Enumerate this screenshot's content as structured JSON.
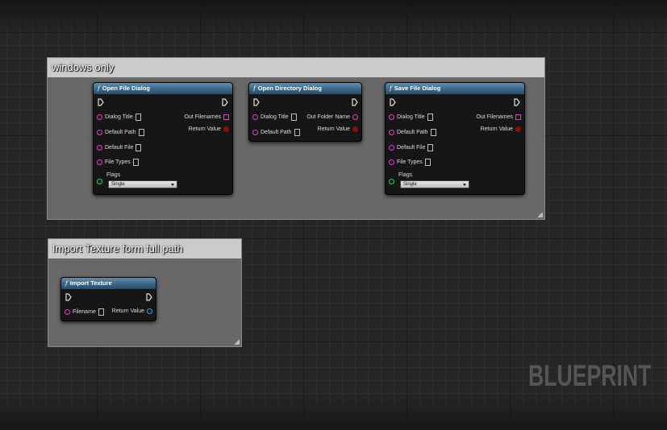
{
  "comments": {
    "windows_only": {
      "title": "windows only"
    },
    "import_texture": {
      "title": "Import Texture form  full path"
    }
  },
  "nodes": {
    "open_file": {
      "title": "Open File Dialog",
      "inputs": [
        "Dialog Title",
        "Default Path",
        "Default File",
        "File Types"
      ],
      "outputs": [
        "Out Filenames",
        "Return Value"
      ],
      "flags_label": "Flags",
      "flags_value": "Single"
    },
    "open_directory": {
      "title": "Open Directory Dialog",
      "inputs": [
        "Dialog Title",
        "Default Path"
      ],
      "outputs": [
        "Out Folder Name",
        "Return Value"
      ]
    },
    "save_file": {
      "title": "Save File Dialog",
      "inputs": [
        "Dialog Title",
        "Default Path",
        "Default File",
        "File Types"
      ],
      "outputs": [
        "Out Filenames",
        "Return Value"
      ],
      "flags_label": "Flags",
      "flags_value": "Single"
    },
    "import_texture": {
      "title": "Import Texture",
      "inputs": [
        "Filename"
      ],
      "outputs": [
        "Return Value"
      ]
    }
  },
  "function_icon": "function-f-icon",
  "watermark": "BLUEPRINT",
  "colors": {
    "string_pin": "#e23fc8",
    "byte_pin": "#2fcf72",
    "object_pin": "#29a9e8",
    "bool_pin": "#8a0f0f",
    "node_header": "#3b6788"
  }
}
